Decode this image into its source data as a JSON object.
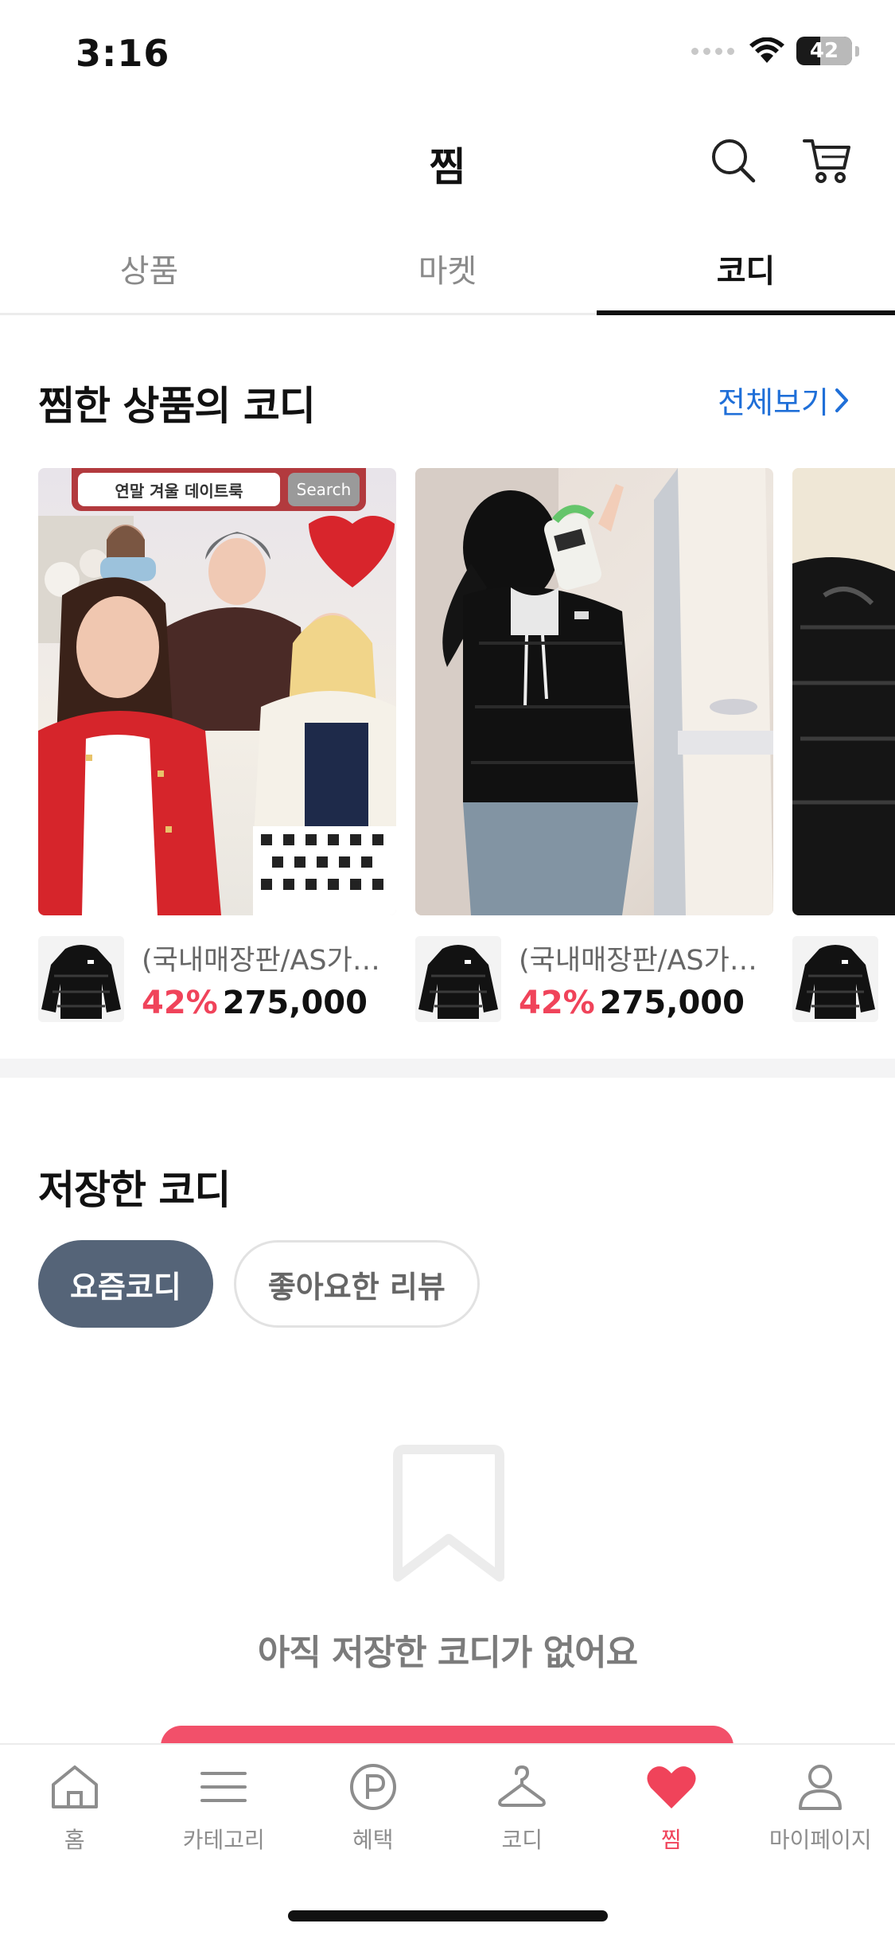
{
  "status_bar": {
    "time": "3:16",
    "battery": "42"
  },
  "header": {
    "title": "찜",
    "search_icon": "search-icon",
    "cart_icon": "cart-icon"
  },
  "tabs": [
    {
      "label": "상품",
      "active": false
    },
    {
      "label": "마켓",
      "active": false
    },
    {
      "label": "코디",
      "active": true
    }
  ],
  "liked_coordi": {
    "title": "찜한 상품의 코디",
    "see_all": "전체보기",
    "cards": [
      {
        "search_banner_text": "연말 겨울 데이트룩",
        "search_button": "Search",
        "product": {
          "name": "(국내매장판/AS가능...",
          "discount": "42%",
          "price": "275,000"
        }
      },
      {
        "product": {
          "name": "(국내매장판/AS가능...",
          "discount": "42%",
          "price": "275,000"
        }
      }
    ]
  },
  "saved_coordi": {
    "title": "저장한 코디",
    "chips": [
      {
        "label": "요즘코디",
        "active": true
      },
      {
        "label": "좋아요한 리뷰",
        "active": false
      }
    ],
    "empty_message": "아직 저장한 코디가 없어요"
  },
  "colors": {
    "accent": "#f0435a",
    "link": "#1f6fd8",
    "chip_active": "#556478"
  },
  "bottom_nav": [
    {
      "label": "홈",
      "icon": "home-icon",
      "active": false
    },
    {
      "label": "카테고리",
      "icon": "menu-icon",
      "active": false
    },
    {
      "label": "혜택",
      "icon": "point-icon",
      "active": false
    },
    {
      "label": "코디",
      "icon": "hanger-icon",
      "active": false
    },
    {
      "label": "찜",
      "icon": "heart-icon",
      "active": true
    },
    {
      "label": "마이페이지",
      "icon": "user-icon",
      "active": false
    }
  ]
}
